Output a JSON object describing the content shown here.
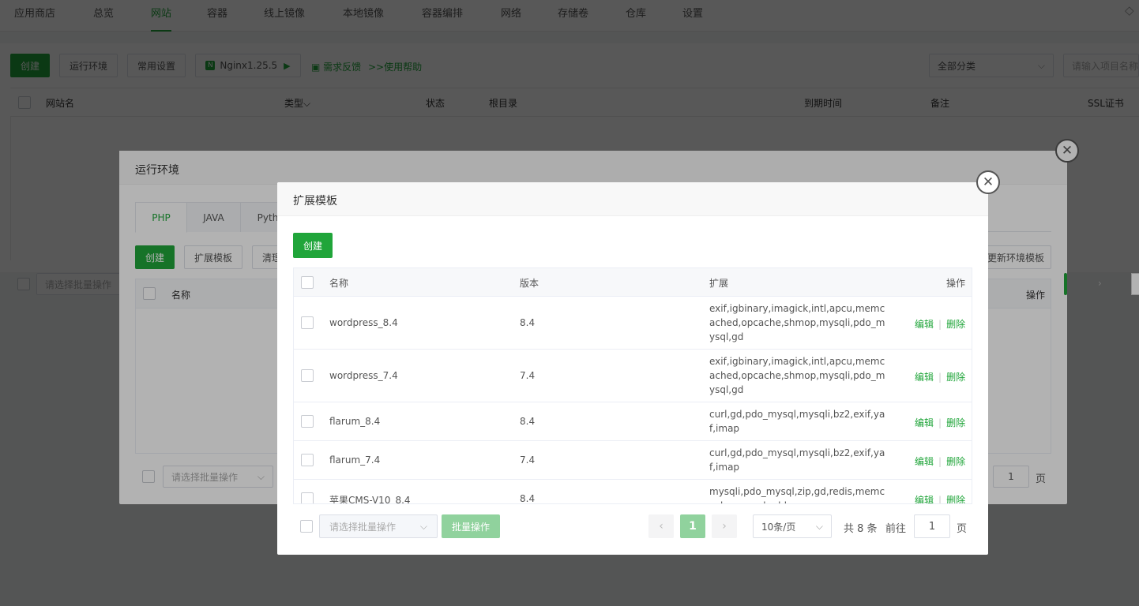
{
  "top_nav": {
    "items": [
      "应用商店",
      "总览",
      "网站",
      "容器",
      "线上镜像",
      "本地镜像",
      "容器编排",
      "网络",
      "存储卷",
      "仓库",
      "设置"
    ],
    "active": "网站"
  },
  "site_toolbar": {
    "create": "创建",
    "runtime": "运行环境",
    "common_settings": "常用设置",
    "nginx": "Nginx1.25.5",
    "feedback": "需求反馈",
    "help": ">>使用帮助",
    "category_select": "全部分类",
    "search_placeholder": "请输入项目名称"
  },
  "site_table": {
    "columns": [
      "网站名",
      "类型",
      "状态",
      "根目录",
      "到期时间",
      "备注",
      "SSL证书"
    ]
  },
  "site_batch": {
    "placeholder": "请选择批量操作"
  },
  "runtime_modal": {
    "title": "运行环境",
    "tabs": [
      "PHP",
      "JAVA",
      "Pyth"
    ],
    "create": "创建",
    "ext_template": "扩展模板",
    "clear": "清理",
    "update_template": "更新环境模板",
    "columns": {
      "name": "名称",
      "ops": "操作"
    },
    "batch_placeholder": "请选择批量操作",
    "page_input": "1",
    "page_label": "页"
  },
  "ext_modal": {
    "title": "扩展模板",
    "create": "创建",
    "columns": {
      "name": "名称",
      "version": "版本",
      "ext": "扩展",
      "ops": "操作"
    },
    "rows": [
      {
        "name": "wordpress_8.4",
        "version": "8.4",
        "ext": "exif,igbinary,imagick,intl,apcu,memcached,opcache,shmop,mysqli,pdo_mysql,gd"
      },
      {
        "name": "wordpress_7.4",
        "version": "7.4",
        "ext": "exif,igbinary,imagick,intl,apcu,memcached,opcache,shmop,mysqli,pdo_mysql,gd"
      },
      {
        "name": "flarum_8.4",
        "version": "8.4",
        "ext": "curl,gd,pdo_mysql,mysqli,bz2,exif,yaf,imap"
      },
      {
        "name": "flarum_7.4",
        "version": "7.4",
        "ext": "curl,gd,pdo_mysql,mysqli,bz2,exif,yaf,imap"
      },
      {
        "name": "苹果CMS-V10_8.4",
        "version": "8.4",
        "ext": "mysqli,pdo_mysql,zip,gd,redis,memcache,opcache,ldap"
      }
    ],
    "edit": "编辑",
    "delete": "删除",
    "batch_placeholder": "请选择批量操作",
    "batch_btn": "批量操作",
    "pagination": {
      "current": "1",
      "page_size": "10条/页",
      "total": "共 8 条",
      "goto": "前往",
      "page_input": "1",
      "page_label": "页"
    }
  },
  "colors": {
    "brand": "#20a53a",
    "overlay": "rgba(0,0,0,0.5)"
  }
}
